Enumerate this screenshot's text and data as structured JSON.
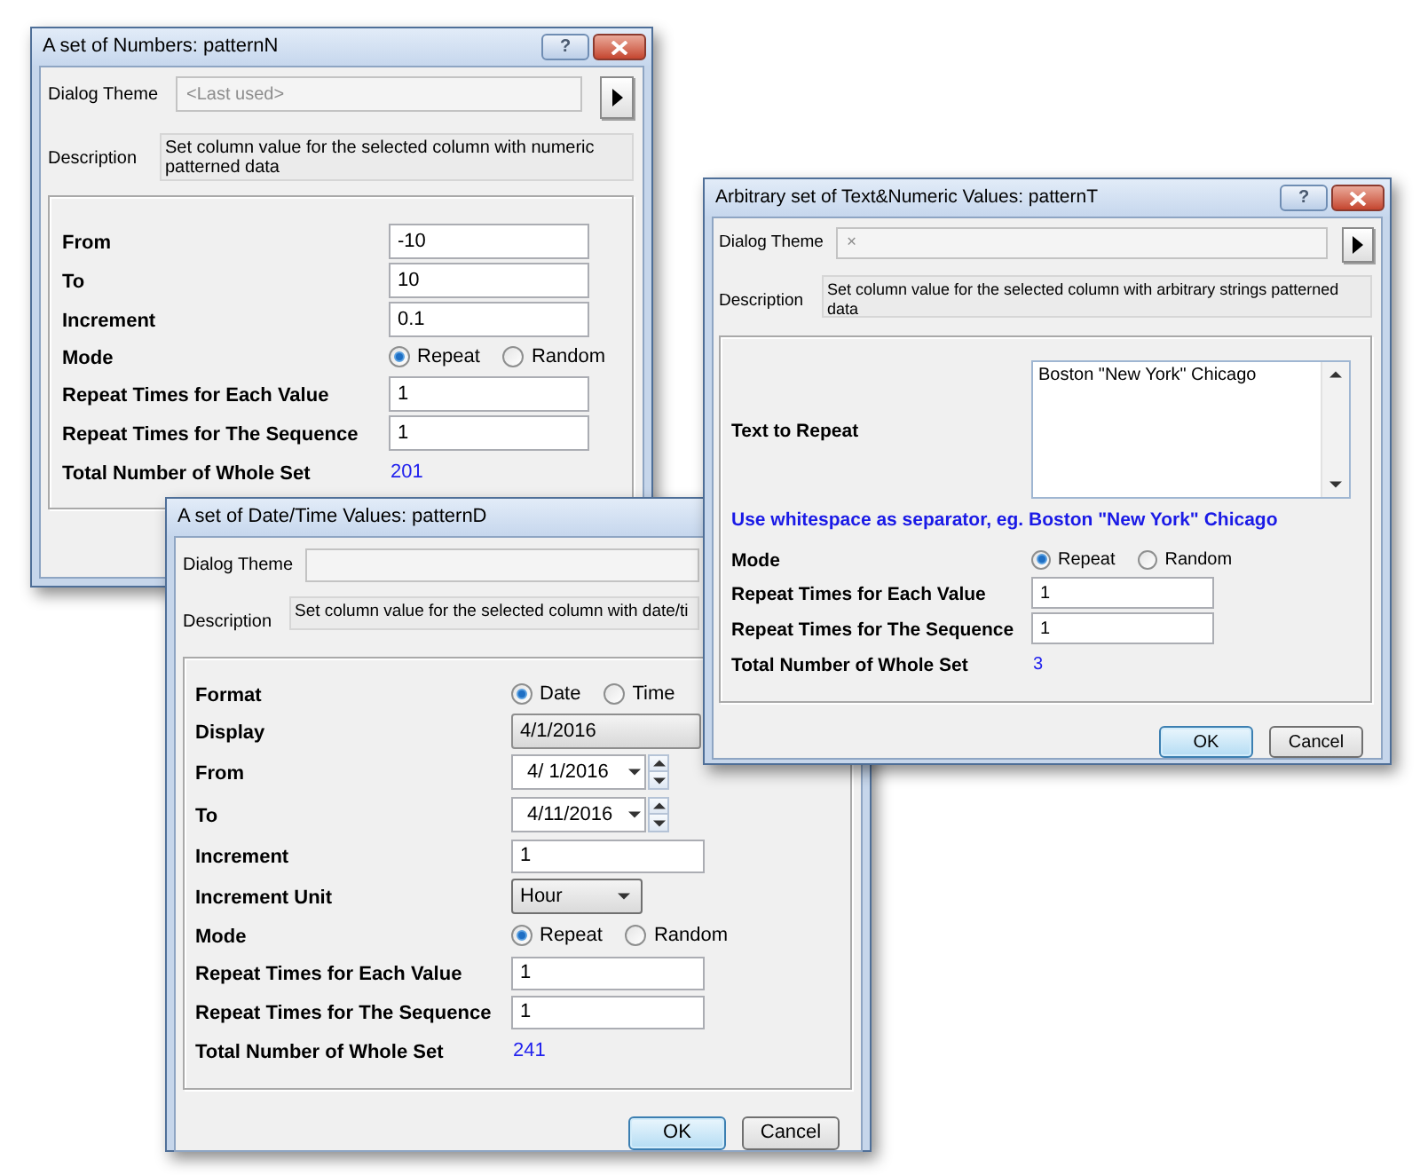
{
  "dialogs": [
    {
      "title": "A set of Numbers: patternN",
      "title_buttons": [
        {
          "kind": "help",
          "label": "?"
        },
        {
          "kind": "close"
        }
      ],
      "theme": {
        "label": "Dialog Theme",
        "value": "<Last used>",
        "disabled": true,
        "menu_button": true
      },
      "description": {
        "label": "Description",
        "text": "Set column value for the selected column with numeric patterned data"
      },
      "rows": [
        {
          "kind": "text",
          "label": "From",
          "value": "-10"
        },
        {
          "kind": "text",
          "label": "To",
          "value": "10"
        },
        {
          "kind": "text",
          "label": "Increment",
          "value": "0.1"
        },
        {
          "kind": "radio",
          "label": "Mode",
          "options": [
            {
              "label": "Repeat",
              "selected": true
            },
            {
              "label": "Random",
              "selected": false
            }
          ]
        },
        {
          "kind": "text",
          "label": "Repeat Times for Each Value",
          "value": "1"
        },
        {
          "kind": "text",
          "label": "Repeat Times for The Sequence",
          "value": "1"
        },
        {
          "kind": "total",
          "label": "Total Number of Whole Set",
          "value": "201"
        }
      ]
    },
    {
      "title": "A set of Date/Time Values: patternD",
      "theme": {
        "label": "Dialog Theme",
        "disabled": true
      },
      "description": {
        "label": "Description",
        "text": "Set column value for the selected column with date/ti"
      },
      "rows": [
        {
          "kind": "radio",
          "label": "Format",
          "options": [
            {
              "label": "Date",
              "selected": true
            },
            {
              "label": "Time",
              "selected": false
            }
          ]
        },
        {
          "kind": "display",
          "label": "Display",
          "value": "4/1/2016"
        },
        {
          "kind": "date",
          "label": "From",
          "value": "4/ 1/2016"
        },
        {
          "kind": "date",
          "label": "To",
          "value": "4/11/2016"
        },
        {
          "kind": "text",
          "label": "Increment",
          "value": "1"
        },
        {
          "kind": "dropdown",
          "label": "Increment Unit",
          "value": "Hour"
        },
        {
          "kind": "radio",
          "label": "Mode",
          "options": [
            {
              "label": "Repeat",
              "selected": true
            },
            {
              "label": "Random",
              "selected": false
            }
          ]
        },
        {
          "kind": "text",
          "label": "Repeat Times for Each Value",
          "value": "1"
        },
        {
          "kind": "text",
          "label": "Repeat Times for The Sequence",
          "value": "1"
        },
        {
          "kind": "total",
          "label": "Total Number of Whole Set",
          "value": "241"
        }
      ],
      "buttons": [
        {
          "label": "OK",
          "default": true
        },
        {
          "label": "Cancel",
          "default": false
        }
      ]
    },
    {
      "title": "Arbitrary set of Text&Numeric Values: patternT",
      "title_buttons": [
        {
          "kind": "help",
          "label": "?"
        },
        {
          "kind": "close"
        }
      ],
      "theme": {
        "label": "Dialog Theme",
        "value": "×",
        "disabled": true,
        "menu_button": true
      },
      "description": {
        "label": "Description",
        "text": "Set column value for the selected column with arbitrary strings patterned data"
      },
      "rows": [
        {
          "kind": "textarea",
          "label": "Text to Repeat",
          "value": "Boston \"New York\" Chicago"
        },
        {
          "kind": "note",
          "text": "Use whitespace as separator, eg. Boston \"New York\" Chicago"
        },
        {
          "kind": "radio",
          "label": "Mode",
          "options": [
            {
              "label": "Repeat",
              "selected": true
            },
            {
              "label": "Random",
              "selected": false
            }
          ]
        },
        {
          "kind": "text",
          "label": "Repeat Times for Each Value",
          "value": "1"
        },
        {
          "kind": "text",
          "label": "Repeat Times for The Sequence",
          "value": "1"
        },
        {
          "kind": "total",
          "label": "Total Number of Whole Set",
          "value": "3"
        }
      ],
      "buttons": [
        {
          "label": "OK",
          "default": true
        },
        {
          "label": "Cancel",
          "default": false
        }
      ]
    }
  ]
}
